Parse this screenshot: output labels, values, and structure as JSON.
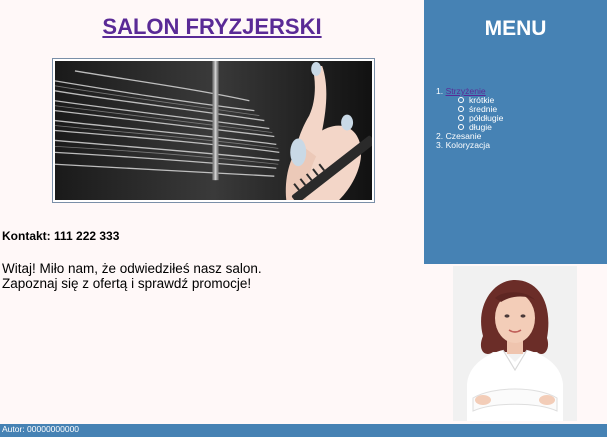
{
  "header": {
    "title": "SALON FRYZJERSKI"
  },
  "contact": {
    "text": "Kontakt: 111 222 333"
  },
  "welcome": {
    "line1": "Witaj! Miło nam, że odwiedziłeś nasz salon.",
    "line2": "Zapoznaj się z ofertą i sprawdź promocje!"
  },
  "menu": {
    "title": "MENU",
    "items": [
      {
        "number": "1.",
        "label": "Strzyżenie",
        "sub": [
          "krótkie",
          "średnie",
          "półdługie",
          "długie"
        ]
      },
      {
        "number": "2.",
        "label": "Czesanie"
      },
      {
        "number": "3.",
        "label": "Koloryzacja"
      }
    ]
  },
  "footer": {
    "text": "Autor: 00000000000"
  },
  "colors": {
    "menu_background": "#4682b4",
    "link": "#5a2a96",
    "page_background": "#fff8f8"
  }
}
